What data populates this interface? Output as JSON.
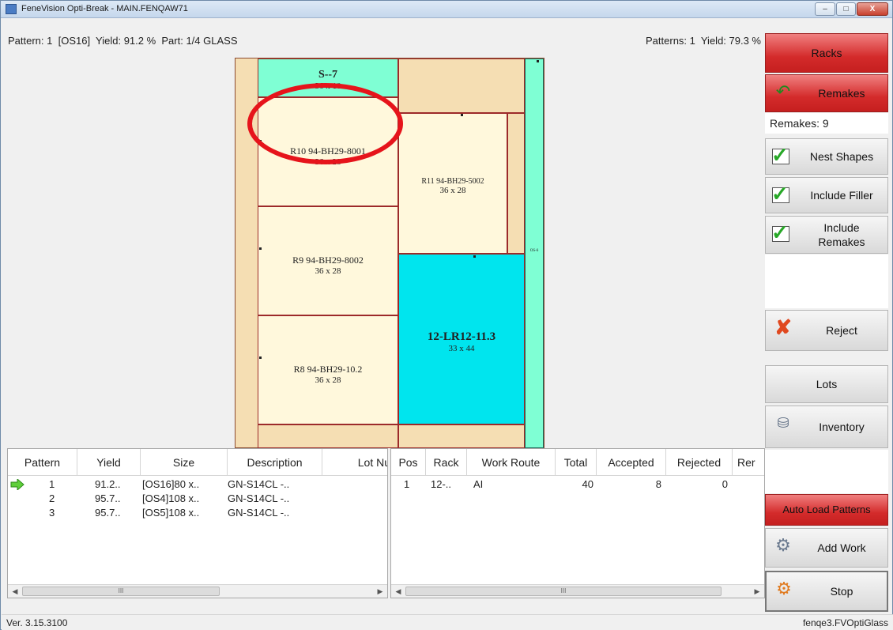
{
  "window": {
    "title": "FeneVision Opti-Break - MAIN.FENQAW71",
    "minimize_label": "–",
    "maximize_label": "□",
    "close_label": "X"
  },
  "info": {
    "left": "Pattern: 1  [OS16]  Yield: 91.2 %  Part: 1/4 GLASS",
    "right": "Patterns: 1  Yield: 79.3 %"
  },
  "glass": {
    "pieces": {
      "s7": {
        "label": "S--7",
        "dim": "36 x 10"
      },
      "r10": {
        "label": "R10 94-BH29-8001",
        "dim": "36 x 28"
      },
      "r9": {
        "label": "R9 94-BH29-8002",
        "dim": "36 x 28"
      },
      "r8": {
        "label": "R8 94-BH29-10.2",
        "dim": "36 x 28"
      },
      "r11": {
        "label": "R11 94-BH29-5002",
        "dim": "36 x 28"
      },
      "lr12": {
        "label": "12-LR12-11.3",
        "dim": "33 x 44"
      },
      "os": {
        "label": "OS-6"
      }
    }
  },
  "sidebar": {
    "racks": "Racks",
    "remakes": "Remakes",
    "remakes_count": "Remakes: 9",
    "nest_shapes": "Nest Shapes",
    "include_filler": "Include Filler",
    "include_remakes": "Include Remakes",
    "reject": "Reject",
    "lots": "Lots",
    "inventory": "Inventory",
    "auto_load": "Auto Load Patterns",
    "add_work": "Add Work",
    "stop": "Stop"
  },
  "patterns_table": {
    "headers": [
      "Pattern",
      "Yield",
      "Size",
      "Description",
      "Lot Nu"
    ],
    "rows": [
      {
        "pattern": "1",
        "yield": "91.2..",
        "size": "[OS16]80 x..",
        "description": "GN-S14CL -.."
      },
      {
        "pattern": "2",
        "yield": "95.7..",
        "size": "[OS4]108 x..",
        "description": "GN-S14CL -.."
      },
      {
        "pattern": "3",
        "yield": "95.7..",
        "size": "[OS5]108 x..",
        "description": "GN-S14CL -.."
      }
    ],
    "scroll_thumb": "III"
  },
  "racks_table": {
    "headers": [
      "Pos",
      "Rack",
      "Work Route",
      "Total",
      "Accepted",
      "Rejected",
      "Rer"
    ],
    "rows": [
      {
        "pos": "1",
        "rack": "12-..",
        "route": "AI",
        "total": "40",
        "accepted": "8",
        "rejected": "0"
      }
    ],
    "scroll_thumb": "III"
  },
  "status": {
    "version": "Ver. 3.15.3100",
    "host": "fenqe3.FVOptiGlass"
  }
}
